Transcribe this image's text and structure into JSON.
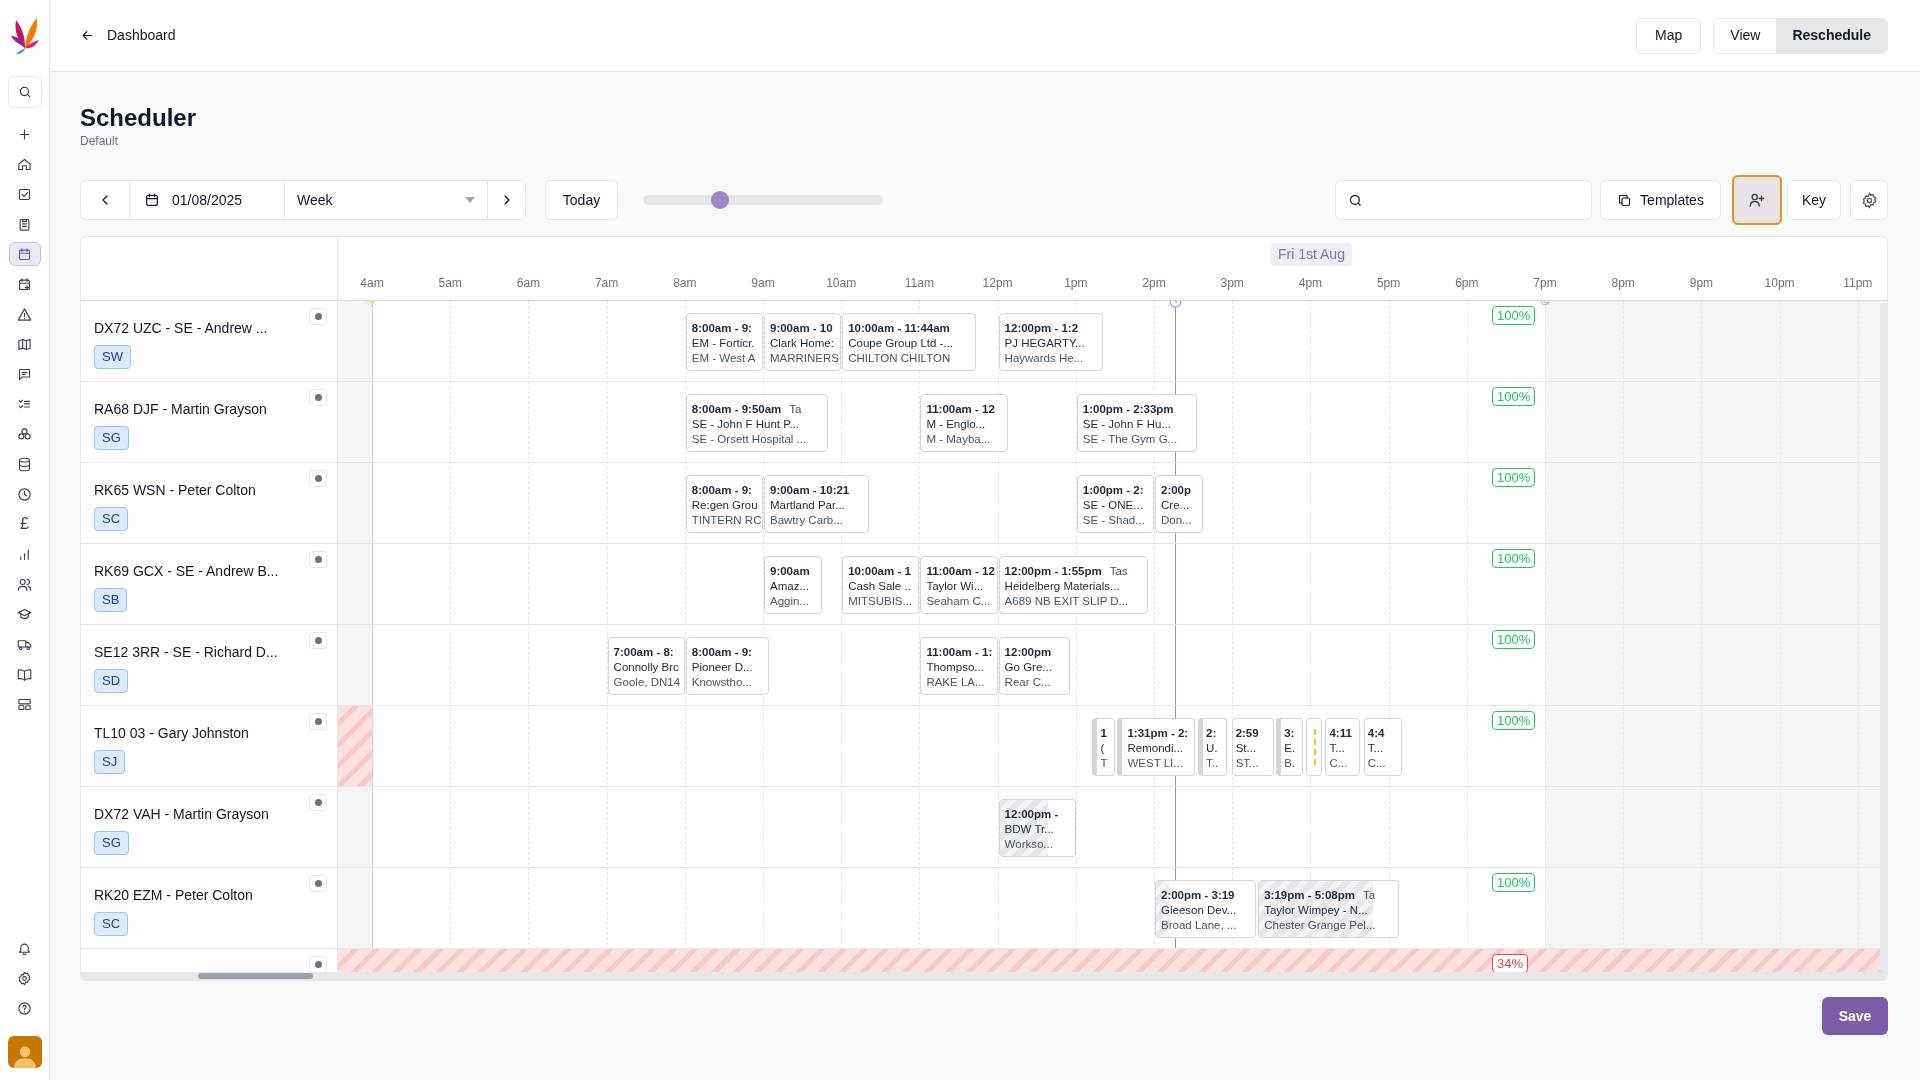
{
  "top_bar": {
    "back_link": "Dashboard",
    "buttons": [
      {
        "label": "Map"
      }
    ],
    "view_toggle": [
      {
        "label": "View",
        "selected": false
      },
      {
        "label": "Reschedule",
        "selected": true
      }
    ]
  },
  "sidebar": {
    "items": [
      {
        "selected": false
      },
      {
        "selected": false
      },
      {
        "selected": false
      },
      {
        "selected": false
      },
      {
        "selected": true
      },
      {
        "selected": false
      },
      {
        "selected": false
      },
      {
        "selected": false
      },
      {
        "selected": false
      },
      {
        "selected": false
      },
      {
        "selected": false
      },
      {
        "selected": false
      },
      {
        "selected": false
      },
      {
        "selected": false,
        "label": "£"
      },
      {
        "selected": false
      },
      {
        "selected": false
      },
      {
        "selected": false
      },
      {
        "selected": false
      },
      {
        "selected": false
      },
      {
        "selected": false
      }
    ]
  },
  "page": {
    "title": "Scheduler",
    "subtitle": "Default"
  },
  "toolbar": {
    "date": "01/08/2025",
    "range": "Week",
    "today": "Today",
    "zoom": {
      "level": 0.32
    },
    "templates": "Templates",
    "assign_button": {
      "focused": true
    },
    "key": "Key"
  },
  "timeline": {
    "date_label": "Fri 1st Aug",
    "hours": [
      "4am",
      "5am",
      "6am",
      "7am",
      "8am",
      "9am",
      "10am",
      "11am",
      "12pm",
      "1pm",
      "2pm",
      "3pm",
      "4pm",
      "5pm",
      "6pm",
      "7pm",
      "8pm",
      "9pm",
      "10pm",
      "11pm"
    ]
  },
  "rows": [
    {
      "label": "DX72 UZC - SE - Andrew ...",
      "tag": "SW",
      "early_blocked": false,
      "blocked": false,
      "utilisation": {
        "text": "100%",
        "color": "#22c55e"
      },
      "events": [
        {
          "kind": "job",
          "time": "8:00am - 9:",
          "lines": [
            "EM - Forticr.",
            "EM - West A"
          ]
        },
        {
          "kind": "job",
          "time": "9:00am - 10",
          "lines": [
            "Clark Home:",
            "MARRINERS"
          ]
        },
        {
          "kind": "job",
          "time": "10:00am - 11:44am",
          "lines": [
            "Coupe Group Ltd -...",
            "CHILTON CHILTON"
          ]
        },
        {
          "kind": "job",
          "time": "12:00pm - 1:2",
          "lines": [
            "PJ HEGARTY...",
            "Haywards He..."
          ]
        }
      ]
    },
    {
      "label": "RA68 DJF - Martin Grayson",
      "tag": "SG",
      "early_blocked": false,
      "blocked": false,
      "utilisation": {
        "text": "100%",
        "color": "#22c55e"
      },
      "events": [
        {
          "kind": "job",
          "time": "8:00am - 9:50am",
          "tag": "Ta",
          "lines": [
            "SE - John F Hunt P...",
            "SE - Orsett Hospital ..."
          ]
        },
        {
          "kind": "job",
          "time": "11:00am - 12",
          "lines": [
            "M - Englo...",
            "M - Mayba..."
          ]
        },
        {
          "kind": "job",
          "time": "1:00pm - 2:33pm",
          "lines": [
            "SE - John F Hu...",
            "SE - The Gym G..."
          ]
        }
      ]
    },
    {
      "label": "RK65 WSN - Peter Colton",
      "tag": "SC",
      "early_blocked": false,
      "blocked": false,
      "utilisation": {
        "text": "100%",
        "color": "#22c55e"
      },
      "events": [
        {
          "kind": "job",
          "time": "8:00am - 9:",
          "lines": [
            "Re:gen Grou",
            "TINTERN RC"
          ]
        },
        {
          "kind": "job",
          "time": "9:00am - 10:21",
          "lines": [
            "Martland Par...",
            "Bawtry Carb..."
          ]
        },
        {
          "kind": "job",
          "time": "1:00pm - 2:",
          "lines": [
            "SE - ONE...",
            "SE - Shad..."
          ]
        },
        {
          "kind": "job",
          "time": "2:00p",
          "lines": [
            "Cre...",
            "Don..."
          ]
        }
      ]
    },
    {
      "label": "RK69 GCX - SE - Andrew B...",
      "tag": "SB",
      "early_blocked": false,
      "blocked": false,
      "utilisation": {
        "text": "100%",
        "color": "#22c55e"
      },
      "events": [
        {
          "kind": "job",
          "time": "9:00am",
          "lines": [
            "Amaz...",
            "Aggin..."
          ]
        },
        {
          "kind": "job",
          "time": "10:00am - 1",
          "lines": [
            "Cash Sale ..",
            "MITSUBIS..."
          ]
        },
        {
          "kind": "job",
          "time": "11:00am - 12",
          "lines": [
            "Taylor Wi...",
            "Seaham C..."
          ]
        },
        {
          "kind": "job",
          "time": "12:00pm - 1:55pm",
          "tag": "Tas",
          "lines": [
            "Heidelberg Materials...",
            "A689 NB EXIT SLIP D..."
          ]
        }
      ]
    },
    {
      "label": "SE12 3RR - SE - Richard D...",
      "tag": "SD",
      "early_blocked": false,
      "blocked": false,
      "utilisation": {
        "text": "100%",
        "color": "#22c55e"
      },
      "events": [
        {
          "kind": "job",
          "time": "7:00am - 8:",
          "lines": [
            "Connolly Brc",
            "Goole, DN14"
          ]
        },
        {
          "kind": "job",
          "time": "8:00am - 9:",
          "lines": [
            "Pioneer D...",
            "Knowstho..."
          ]
        },
        {
          "kind": "job",
          "time": "11:00am - 1:",
          "lines": [
            "Thompso...",
            "RAKE LA..."
          ]
        },
        {
          "kind": "job",
          "time": "12:00pm",
          "lines": [
            "Go Gre...",
            "Rear C..."
          ]
        }
      ]
    },
    {
      "label": "TL10 03 - Gary Johnston",
      "tag": "SJ",
      "early_blocked": true,
      "blocked": false,
      "utilisation": {
        "text": "100%",
        "color": "#22c55e"
      },
      "events": [
        {
          "kind": "job",
          "time": "1",
          "lines": [
            "(",
            "T"
          ],
          "hatched_edge": true
        },
        {
          "kind": "job",
          "time": "1:31pm - 2:",
          "lines": [
            "Remondi...",
            "WEST LI..."
          ],
          "hatched_edge": true
        },
        {
          "kind": "job",
          "time": "2:",
          "lines": [
            "U.",
            "T.."
          ],
          "hatched_edge": true
        },
        {
          "kind": "job",
          "time": "2:59",
          "lines": [
            "St...",
            "ST..."
          ],
          "hatched_edge": false
        },
        {
          "kind": "job",
          "time": "3:",
          "lines": [
            "E.",
            "B."
          ],
          "hatched_edge": true
        },
        {
          "kind": "marker",
          "hatched_edge": false
        },
        {
          "kind": "job",
          "time": "4:11",
          "lines": [
            "T...",
            "C..."
          ],
          "hatched_edge": false
        },
        {
          "kind": "job",
          "time": "4:4",
          "lines": [
            "T...",
            "C..."
          ],
          "hatched_edge": false
        }
      ]
    },
    {
      "label": "DX72 VAH - Martin Grayson",
      "tag": "SG",
      "early_blocked": false,
      "blocked": false,
      "events": [
        {
          "kind": "job",
          "time": "12:00pm -",
          "lines": [
            "BDW Tr...",
            "Workso..."
          ],
          "level": 0.65
        }
      ]
    },
    {
      "label": "RK20 EZM - Peter Colton",
      "tag": "SC",
      "early_blocked": false,
      "blocked": false,
      "utilisation": {
        "text": "100%",
        "color": "#22c55e"
      },
      "events": [
        {
          "kind": "job",
          "time": "2:00pm - 3:19",
          "lines": [
            "Gleeson Dev...",
            "Broad Lane, ..."
          ],
          "level": 0.13
        },
        {
          "kind": "job",
          "time": "3:19pm - 5:08pm",
          "tag": "Ta",
          "lines": [
            "Taylor Wimpey - N...",
            "Chester Grange Pel..."
          ],
          "level": 0.82
        }
      ]
    },
    {
      "early_blocked": false,
      "blocked": true,
      "utilisation": {
        "text": "34%",
        "color": "#ef4444"
      },
      "events": []
    }
  ],
  "save": "Save"
}
